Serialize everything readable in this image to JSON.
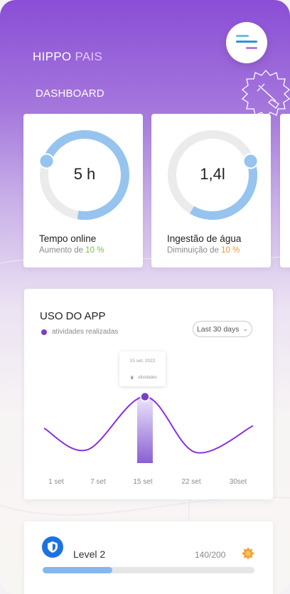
{
  "app": {
    "brand_primary": "HIPPO",
    "brand_accent": "PAIS"
  },
  "header": {
    "title": "DASHBOARD",
    "menu_icon": "menu-icon",
    "badge_icon": "broom-badge-icon"
  },
  "stats": [
    {
      "value": "5 h",
      "label": "Tempo online",
      "sub_prefix": "Aumento de ",
      "sub_pct": "10 %",
      "pct_color": "#7ac143",
      "progress": 0.72
    },
    {
      "value": "1,4l",
      "label": "Ingestão de água",
      "sub_prefix": "Diminuição de ",
      "sub_pct": "10 %",
      "pct_color": "#f39b2d",
      "progress": 0.39
    }
  ],
  "usage": {
    "title": "USO DO APP",
    "legend": "atividades realizadas",
    "range": "Last 30 days",
    "tooltip": {
      "date": "15 set, 2022",
      "count": "8",
      "label": "atividades"
    },
    "colors": {
      "line": "#8a2fe0",
      "bar_top": "#ece6fb",
      "bar_bottom": "#8a60d4"
    }
  },
  "chart_data": {
    "type": "line",
    "x_labels": [
      "1 set",
      "7 set",
      "15 set",
      "22  set",
      "30set"
    ],
    "highlight": {
      "x": "15 set",
      "y": 8
    },
    "series": [
      {
        "points": [
          [
            1,
            4.2
          ],
          [
            7,
            1.6
          ],
          [
            15,
            8
          ],
          [
            22,
            1.3
          ],
          [
            30,
            4.5
          ]
        ]
      }
    ]
  },
  "level": {
    "label": "Level 2",
    "progress_text": "140/200",
    "progress": 0.33
  }
}
